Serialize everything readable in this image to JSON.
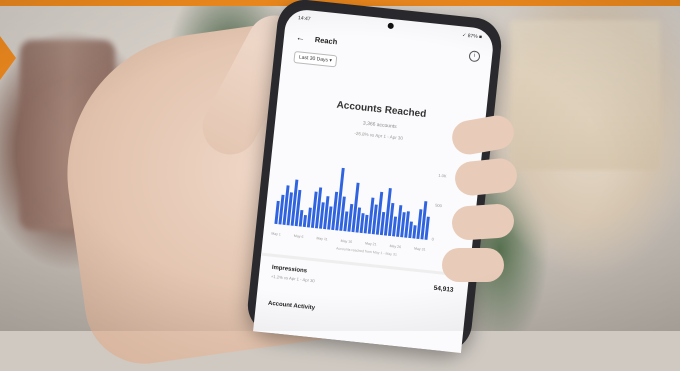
{
  "accent_color": "#f28c1e",
  "phone": {
    "status_time": "14:47",
    "status_right": "✓ 87% ■",
    "header": {
      "back_icon": "arrow-left-icon",
      "title": "Reach",
      "info_icon": "info-icon"
    },
    "range_chip": "Last 30 Days ▾",
    "reach_title": "Accounts Reached",
    "reach_count": "3,366 accounts",
    "reach_change": "-26.8% vs Apr 1 - Apr 30",
    "chart_data": {
      "type": "bar",
      "bar_color": "#2f63e0",
      "values": [
        0.35,
        0.45,
        0.6,
        0.5,
        0.7,
        0.55,
        0.25,
        0.18,
        0.3,
        0.55,
        0.62,
        0.4,
        0.5,
        0.35,
        0.58,
        0.95,
        0.52,
        0.3,
        0.42,
        0.75,
        0.38,
        0.3,
        0.28,
        0.55,
        0.45,
        0.65,
        0.35,
        0.72,
        0.5,
        0.3,
        0.48,
        0.38,
        0.4,
        0.25,
        0.2,
        0.45,
        0.58,
        0.35
      ],
      "y_ticks": [
        "1.0K",
        "500",
        "0"
      ],
      "x_ticks": [
        "May 1",
        "May 6",
        "May 11",
        "May 16",
        "May 21",
        "May 26",
        "May 31"
      ]
    },
    "chart_caption": "Accounts reached from May 1 - May 31",
    "impressions": {
      "label": "Impressions",
      "sub": "+1.2% vs Apr 1 - Apr 30",
      "value": "54,913"
    },
    "activity_label": "Account Activity"
  }
}
